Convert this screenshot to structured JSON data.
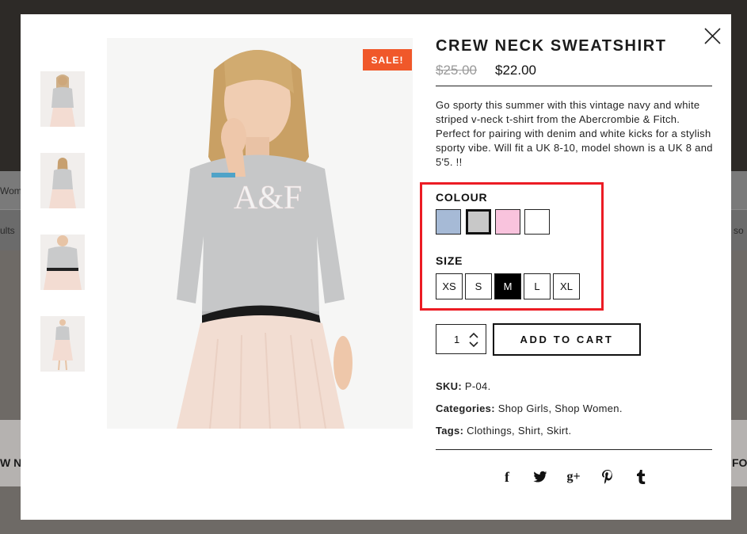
{
  "background": {
    "left_fragments": [
      "Wom",
      "ults",
      "W N"
    ],
    "right_fragments": [
      "so",
      "FO"
    ]
  },
  "product": {
    "title": "CREW NECK SWEATSHIRT",
    "old_price": "$25.00",
    "new_price": "$22.00",
    "sale_badge": "SALE!",
    "description": "Go sporty this summer with this vintage navy and white striped v-neck t-shirt from the Abercrombie & Fitch. Perfect for pairing with denim and white kicks for a stylish sporty vibe. Will fit a UK 8-10, model shown is a UK 8 and 5'5. !!",
    "photo_print": "A&F"
  },
  "thumbnails": [
    {
      "icon": "model-front-thumb"
    },
    {
      "icon": "model-back-thumb"
    },
    {
      "icon": "model-closeup-thumb"
    },
    {
      "icon": "model-fullbody-thumb"
    }
  ],
  "options": {
    "colour_label": "COLOUR",
    "colours": [
      {
        "name": "blue",
        "hex": "#a6bad6",
        "selected": false
      },
      {
        "name": "grey",
        "hex": "#c8c8c8",
        "selected": true
      },
      {
        "name": "pink",
        "hex": "#f9c3dd",
        "selected": false
      },
      {
        "name": "white",
        "hex": "#ffffff",
        "selected": false
      }
    ],
    "size_label": "SIZE",
    "sizes": [
      {
        "label": "XS",
        "selected": false
      },
      {
        "label": "S",
        "selected": false
      },
      {
        "label": "M",
        "selected": true
      },
      {
        "label": "L",
        "selected": false
      },
      {
        "label": "XL",
        "selected": false
      }
    ]
  },
  "cart": {
    "quantity": "1",
    "add_to_cart_label": "ADD TO CART"
  },
  "meta": {
    "sku_label": "SKU:",
    "sku_value": "P-04.",
    "categories_label": "Categories:",
    "categories": [
      "Shop Girls",
      "Shop Women"
    ],
    "tags_label": "Tags:",
    "tags": [
      "Clothings",
      "Shirt",
      "Skirt"
    ]
  },
  "share": {
    "facebook": "f",
    "google_plus": "g+"
  },
  "colors": {
    "sale_badge": "#f0582a",
    "highlight_border": "#ec1c24"
  }
}
